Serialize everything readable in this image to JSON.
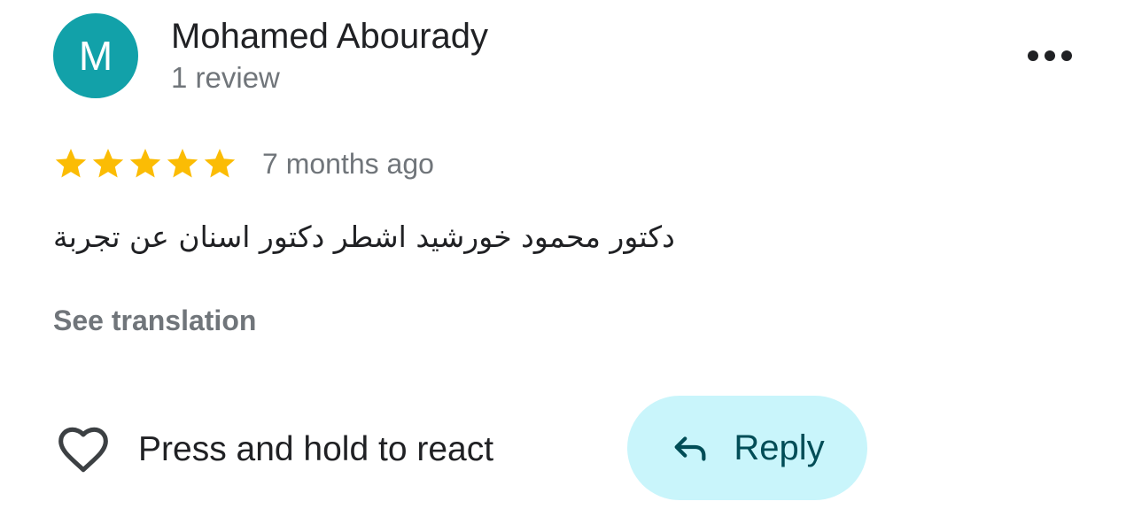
{
  "author": {
    "avatar_initial": "M",
    "avatar_color": "#12a1a9",
    "name": "Mohamed Abourady",
    "review_count": "1 review"
  },
  "menu": {
    "icon": "more-horizontal-icon"
  },
  "review": {
    "rating": 5,
    "max_rating": 5,
    "star_color": "#fbbc04",
    "time_ago": "7 months ago",
    "text": "دكتور محمود خورشيد اشطر دكتور اسنان عن تجربة",
    "translate_label": "See translation"
  },
  "actions": {
    "react_icon": "heart-outline-icon",
    "react_label": "Press and hold to react",
    "reply_icon": "reply-arrow-icon",
    "reply_label": "Reply",
    "reply_background": "#c9f5fb",
    "reply_text_color": "#004d57"
  }
}
